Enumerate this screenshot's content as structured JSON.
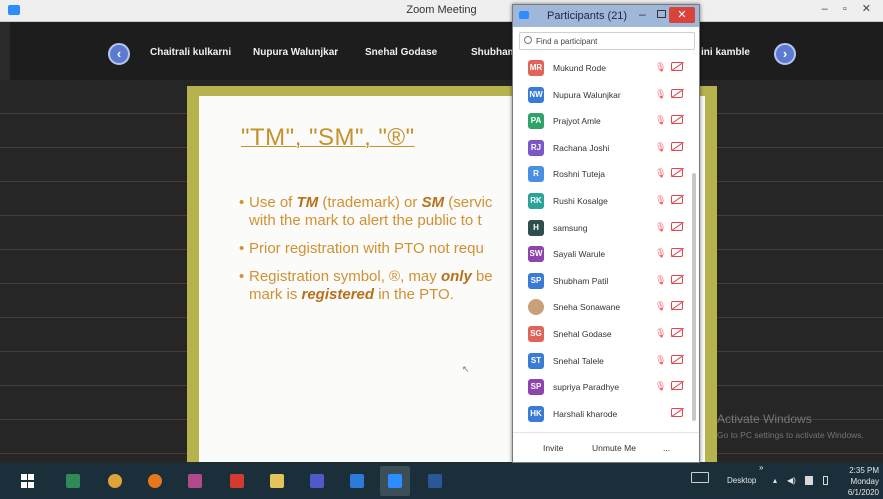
{
  "window": {
    "title": "Zoom Meeting",
    "controls": "– ▫ ✕"
  },
  "video_strip": {
    "prev_label": "‹",
    "next_label": "›",
    "tiles": [
      "Chaitrali kulkarni",
      "Nupura Walunjkar",
      "Snehal Godase",
      "Shubham",
      "ini kamble"
    ]
  },
  "slide": {
    "title": "\"TM\", \"SM\", \"®\"",
    "bullets": [
      {
        "pre": "Use of ",
        "em1": "TM",
        "mid": " (trademark) or ",
        "em2": "SM",
        "post": " (servic"
      },
      {
        "line2": "with the mark to alert the public to t"
      },
      {
        "text": "Prior registration with PTO not requ"
      },
      {
        "pre": "Registration symbol, ®, may ",
        "em1": "only",
        "post": " be"
      },
      {
        "pre": "mark is ",
        "em1": "registered",
        "post": " in the PTO."
      }
    ]
  },
  "participants_panel": {
    "title": "Participants (21)",
    "search_placeholder": "Find a participant",
    "participants": [
      {
        "initials": "MR",
        "name": "Mukund Rode",
        "color": "#e0645a"
      },
      {
        "initials": "NW",
        "name": "Nupura Walunjkar",
        "color": "#3a7bd5"
      },
      {
        "initials": "PA",
        "name": "Prajyot Amle",
        "color": "#2ea36b"
      },
      {
        "initials": "RJ",
        "name": "Rachana Joshi",
        "color": "#7b57c8"
      },
      {
        "initials": "R",
        "name": "Roshni Tuteja",
        "color": "#4a90e2"
      },
      {
        "initials": "RK",
        "name": "Rushi Kosalge",
        "color": "#2aa39a"
      },
      {
        "initials": "H",
        "name": "samsung",
        "color": "#2f4f4f"
      },
      {
        "initials": "SW",
        "name": "Sayali Warule",
        "color": "#8e44ad"
      },
      {
        "initials": "SP",
        "name": "Shubham Patil",
        "color": "#3a7bd5"
      },
      {
        "initials": "",
        "name": "Sneha Sonawane",
        "color": "#c9a07a"
      },
      {
        "initials": "SG",
        "name": "Snehal Godase",
        "color": "#e0645a"
      },
      {
        "initials": "ST",
        "name": "Snehal Talele",
        "color": "#3a7bd5"
      },
      {
        "initials": "SP",
        "name": "supriya Paradhye",
        "color": "#8e44ad"
      },
      {
        "initials": "HK",
        "name": "Harshali kharode",
        "color": "#3a7bd5"
      }
    ],
    "footer": {
      "invite": "Invite",
      "unmute": "Unmute Me",
      "more": "..."
    }
  },
  "watermark": {
    "line1": "Activate Windows",
    "line2": "Go to PC settings to activate Windows."
  },
  "taskbar": {
    "apps": [
      {
        "icon": "windows-start-icon",
        "color": "#1b2f3a"
      },
      {
        "icon": "green-app-icon",
        "color": "#2e8b57"
      },
      {
        "icon": "chrome-icon",
        "color": "#e0a33a"
      },
      {
        "icon": "firefox-icon",
        "color": "#e8771c"
      },
      {
        "icon": "media-player-icon",
        "color": "#b14a8a"
      },
      {
        "icon": "acrobat-icon",
        "color": "#d23b2e"
      },
      {
        "icon": "file-explorer-icon",
        "color": "#e6c35a"
      },
      {
        "icon": "teams-icon",
        "color": "#5059c9"
      },
      {
        "icon": "internet-explorer-icon",
        "color": "#2b7bd8"
      },
      {
        "icon": "zoom-icon",
        "color": "#2d8cff"
      },
      {
        "icon": "word-icon",
        "color": "#2b579a"
      }
    ],
    "tray": {
      "desktop_label": "Desktop",
      "chevron": "»"
    },
    "clock": {
      "time": "2:35 PM",
      "day": "Monday",
      "date": "6/1/2020"
    }
  }
}
